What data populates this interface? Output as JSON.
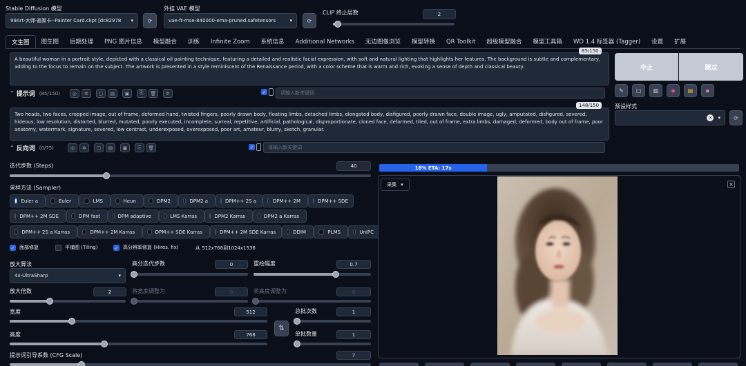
{
  "top": {
    "sd_model_label": "Stable Diffusion 模型",
    "sd_model_value": "99Art-大师-画家卡--Painter Card.ckpt [dc82978",
    "vae_label": "外挂 VAE 模型",
    "vae_value": "vae-ft-mse-840000-ema-pruned.safetensors",
    "clip_label": "CLIP 终止层数",
    "clip_value": "2"
  },
  "tabs": [
    "文生图",
    "图生图",
    "后期处理",
    "PNG 图片信息",
    "模型融合",
    "训练",
    "Infinite Zoom",
    "系统信息",
    "Additional Networks",
    "无边图像浏览",
    "模型转换",
    "QR Toolkit",
    "超级模型融合",
    "模型工具箱",
    "WD 1.4 标签器 (Tagger)",
    "设置",
    "扩展"
  ],
  "prompt": {
    "text": "A beautiful woman in a portrait style, depicted with a classical oil painting technique, featuring a detailed and realistic facial expression, with soft and natural lighting that highlights her features. The background is subtle and complementary, adding to the focus to remain on the subject. The artwork is presented in a style reminiscent of the Renaissance period, with a color scheme that is warm and rich, evoking a sense of depth and classical beauty.",
    "counter": "85/150",
    "title": "提示词",
    "count": "(85/150)",
    "keyword_placeholder": "请输入新关键词"
  },
  "negative": {
    "text": "Two heads, two faces, cropped image, out of frame, deformed hand, twisted fingers, poorly drawn body, floating limbs, detached limbs, elongated body, disfigured, poorly drawn face, double image, ugly, amputated, disfigured, severed, hideous, low resolution, distorted, blurred, mutated, poorly executed, incomplete, surreal, repetitive, artificial, pathological, disproportionate, cloned face, deformed, tiled, out of frame, extra limbs, damaged, deformed, body out of frame, poor anatomy, watermark, signature, severed, low contrast, underexposed, overexposed, poor art, amateur, blurry, sketch, granular.",
    "counter": "148/150",
    "title": "反向词",
    "count": "(0/75)",
    "keyword_placeholder": "请输入新关键词"
  },
  "actions": {
    "interrupt": "中止",
    "skip": "跳过",
    "preset_label": "预设样式"
  },
  "steps": {
    "label": "迭代步数 (Steps)",
    "value": "40",
    "fraction": 0.27
  },
  "sampler": {
    "label": "采样方法 (Sampler)",
    "options": [
      "Euler a",
      "Euler",
      "LMS",
      "Heun",
      "DPM2",
      "DPM2 a",
      "DPM++ 2S a",
      "DPM++ 2M",
      "DPM++ SDE",
      "DPM++ 2M SDE",
      "DPM fast",
      "DPM adaptive",
      "LMS Karras",
      "DPM2 Karras",
      "DPM2 a Karras",
      "DPM++ 2S a Karras",
      "DPM++ 2M Karras",
      "DPM++ SDE Karras",
      "DPM++ 2M SDE Karras",
      "DDIM",
      "PLMS",
      "UniPC"
    ],
    "selected": "Euler a"
  },
  "checks": {
    "face": "面部修复",
    "tiling": "平铺图 (Tiling)",
    "hires": "高分辨率修复 (Hires. fix)",
    "hires_note": "从 512x768到1024x1536"
  },
  "hires": {
    "upscaler_label": "放大算法",
    "upscaler_value": "4x-UltraSharp",
    "hires_steps_label": "高分迭代步数",
    "hires_steps_value": "0",
    "denoise_label": "重绘幅度",
    "denoise_value": "0.7",
    "scale_label": "放大倍数",
    "scale_value": "2",
    "width_to_label": "将宽度调整为",
    "width_to_value": "0",
    "height_to_label": "将高度调整为",
    "height_to_value": "0"
  },
  "size": {
    "width_label": "宽度",
    "width_value": "512",
    "height_label": "高度",
    "height_value": "768",
    "batch_count_label": "总批次数",
    "batch_count_value": "1",
    "batch_size_label": "单批数量",
    "batch_size_value": "1",
    "swap_icon": "⇅"
  },
  "cfg": {
    "label": "提示词引导系数 (CFG Scale)",
    "value": "7"
  },
  "progress": {
    "text": "18% ETA: 17s",
    "fraction": 0.18
  },
  "gallery": {
    "tag": "采集",
    "close": "×"
  },
  "colors": {
    "accent": "#2563eb",
    "bg": "#0b0f19",
    "panel": "#1f2937"
  }
}
